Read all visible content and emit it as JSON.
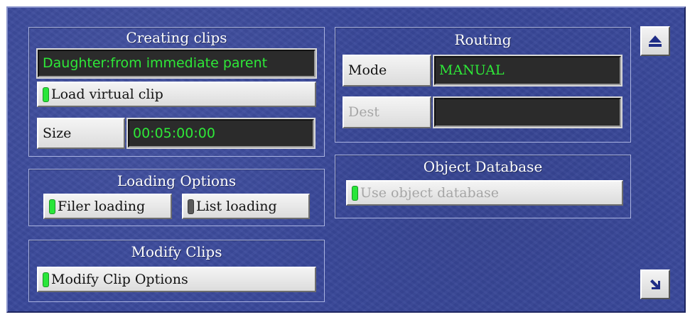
{
  "creating_clips": {
    "title": "Creating clips",
    "daughter_value": "Daughter:from immediate parent",
    "load_virtual_label": "Load virtual clip",
    "load_virtual_on": true,
    "size_label": "Size",
    "size_value": "00:05:00:00"
  },
  "loading_options": {
    "title": "Loading Options",
    "filer_label": "Filer loading",
    "filer_on": true,
    "list_label": "List loading",
    "list_on": false
  },
  "modify_clips": {
    "title": "Modify Clips",
    "options_label": "Modify Clip Options",
    "options_on": true
  },
  "routing": {
    "title": "Routing",
    "mode_label": "Mode",
    "mode_value": "MANUAL",
    "dest_label": "Dest",
    "dest_value": ""
  },
  "object_database": {
    "title": "Object Database",
    "use_label": "Use object database",
    "use_on": true
  },
  "icons": {
    "eject": "eject-icon",
    "arrow": "arrow-down-right-icon"
  },
  "colors": {
    "background": "#39489a",
    "led_on": "#29e63a",
    "led_off": "#5a5a5a",
    "field_text": "#2ee838",
    "icon": "#1f2d86"
  }
}
